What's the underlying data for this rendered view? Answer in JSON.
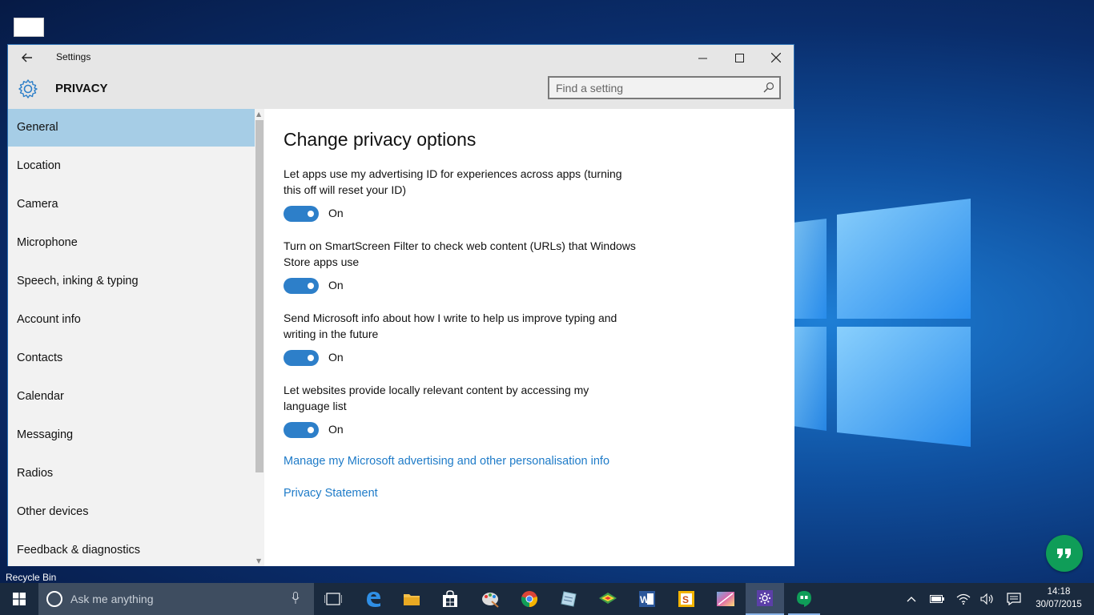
{
  "desktop": {
    "recycle_bin_label": "Recycle Bin"
  },
  "window": {
    "title": "Settings",
    "heading": "PRIVACY",
    "search_placeholder": "Find a setting"
  },
  "sidebar": {
    "items": [
      {
        "label": "General",
        "active": true
      },
      {
        "label": "Location"
      },
      {
        "label": "Camera"
      },
      {
        "label": "Microphone"
      },
      {
        "label": "Speech, inking & typing"
      },
      {
        "label": "Account info"
      },
      {
        "label": "Contacts"
      },
      {
        "label": "Calendar"
      },
      {
        "label": "Messaging"
      },
      {
        "label": "Radios"
      },
      {
        "label": "Other devices"
      },
      {
        "label": "Feedback & diagnostics"
      }
    ]
  },
  "content": {
    "title": "Change privacy options",
    "settings": [
      {
        "description": "Let apps use my advertising ID for experiences across apps (turning this off will reset your ID)",
        "state": "On"
      },
      {
        "description": "Turn on SmartScreen Filter to check web content (URLs) that Windows Store apps use",
        "state": "On"
      },
      {
        "description": "Send Microsoft info about how I write to help us improve typing and writing in the future",
        "state": "On"
      },
      {
        "description": "Let websites provide locally relevant content by accessing my language list",
        "state": "On"
      }
    ],
    "links": [
      "Manage my Microsoft advertising and other personalisation info",
      "Privacy Statement"
    ]
  },
  "taskbar": {
    "search_placeholder": "Ask me anything",
    "pinned_apps": [
      "task-view",
      "edge",
      "file-explorer",
      "store",
      "paint",
      "chrome",
      "notepad",
      "maps",
      "word",
      "slides",
      "photos",
      "settings",
      "hangouts"
    ],
    "clock_time": "14:18",
    "clock_date": "30/07/2015"
  },
  "colors": {
    "accent": "#2d7fc9",
    "link": "#1e7bc8",
    "selected_nav": "#a6cde6",
    "taskbar": "#1a2a3e"
  }
}
